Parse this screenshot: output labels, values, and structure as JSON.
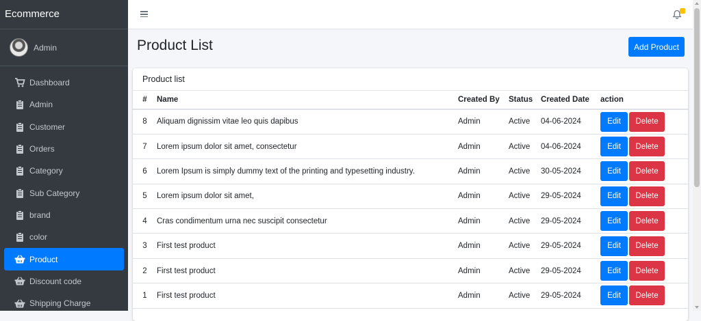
{
  "sidebar": {
    "brand": "Ecommerce",
    "user": "Admin",
    "items": [
      {
        "label": "Dashboard",
        "icon": "cart-icon"
      },
      {
        "label": "Admin",
        "icon": "clipboard-icon"
      },
      {
        "label": "Customer",
        "icon": "clipboard-icon"
      },
      {
        "label": "Orders",
        "icon": "clipboard-icon"
      },
      {
        "label": "Category",
        "icon": "clipboard-icon"
      },
      {
        "label": "Sub Category",
        "icon": "clipboard-icon"
      },
      {
        "label": "brand",
        "icon": "clipboard-icon"
      },
      {
        "label": "color",
        "icon": "clipboard-icon"
      },
      {
        "label": "Product",
        "icon": "basket-icon",
        "active": true
      },
      {
        "label": "Discount code",
        "icon": "basket-icon"
      },
      {
        "label": "Shipping Charge",
        "icon": "basket-icon"
      }
    ]
  },
  "topbar": {
    "menu_icon": "hamburger-icon",
    "notification_icon": "bell-icon",
    "notification_badge": ""
  },
  "page": {
    "title": "Product List",
    "add_button": "Add Product"
  },
  "card": {
    "title": "Product list",
    "columns": [
      "#",
      "Name",
      "Created By",
      "Status",
      "Created Date",
      "action"
    ],
    "rows": [
      {
        "num": "8",
        "name": "Aliquam dignissim vitae leo quis dapibus",
        "created_by": "Admin",
        "status": "Active",
        "date": "04-06-2024"
      },
      {
        "num": "7",
        "name": "Lorem ipsum dolor sit amet, consectetur",
        "created_by": "Admin",
        "status": "Active",
        "date": "04-06-2024"
      },
      {
        "num": "6",
        "name": "Lorem Ipsum is simply dummy text of the printing and typesetting industry.",
        "created_by": "Admin",
        "status": "Active",
        "date": "30-05-2024"
      },
      {
        "num": "5",
        "name": "Lorem ipsum dolor sit amet,",
        "created_by": "Admin",
        "status": "Active",
        "date": "29-05-2024"
      },
      {
        "num": "4",
        "name": "Cras condimentum urna nec suscipit consectetur",
        "created_by": "Admin",
        "status": "Active",
        "date": "29-05-2024"
      },
      {
        "num": "3",
        "name": "First test product",
        "created_by": "Admin",
        "status": "Active",
        "date": "29-05-2024"
      },
      {
        "num": "2",
        "name": "First test product",
        "created_by": "Admin",
        "status": "Active",
        "date": "29-05-2024"
      },
      {
        "num": "1",
        "name": "First test product",
        "created_by": "Admin",
        "status": "Active",
        "date": "29-05-2024"
      }
    ],
    "edit_label": "Edit",
    "delete_label": "Delete"
  },
  "colors": {
    "sidebar_bg": "#343a40",
    "primary": "#007bff",
    "danger": "#dc3545",
    "badge": "#ffc107"
  }
}
